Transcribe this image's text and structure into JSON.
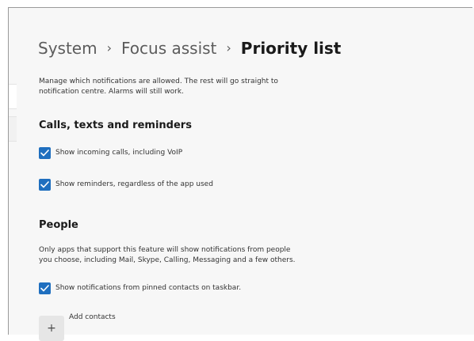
{
  "breadcrumb": {
    "items": [
      "System",
      "Focus assist",
      "Priority list"
    ],
    "separator": "›"
  },
  "intro": {
    "line1": "Manage which notifications are allowed. The rest will go straight to",
    "line2": "notification centre. Alarms will still work."
  },
  "calls_section": {
    "title": "Calls, texts and reminders",
    "options": [
      {
        "label": "Show incoming calls, including VoIP",
        "checked": true
      },
      {
        "label": "Show reminders, regardless of the app used",
        "checked": true
      }
    ]
  },
  "people_section": {
    "title": "People",
    "desc_line1": "Only apps that support this feature will show notifications from people",
    "desc_line2": "you choose, including Mail, Skype, Calling, Messaging and a few others.",
    "options": [
      {
        "label": "Show notifications from pinned contacts on taskbar.",
        "checked": true
      }
    ],
    "add_button_icon": "+",
    "add_label": "Add contacts"
  },
  "colors": {
    "accent": "#1f6fbf",
    "background": "#f7f7f7"
  }
}
